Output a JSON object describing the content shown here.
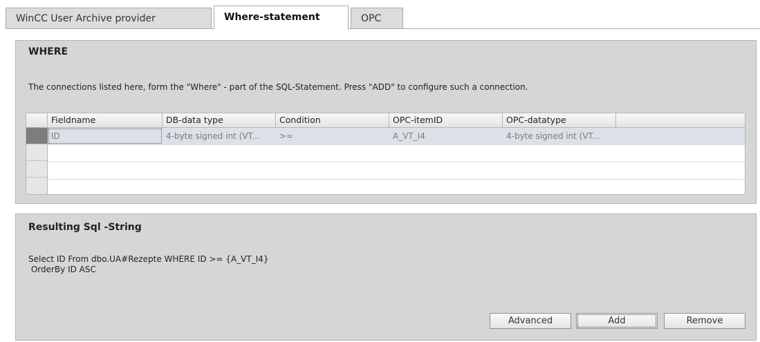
{
  "tabs": [
    {
      "label": "WinCC User Archive provider",
      "active": false
    },
    {
      "label": "Where-statement",
      "active": true
    },
    {
      "label": "OPC",
      "active": false
    }
  ],
  "where": {
    "title": "WHERE",
    "description": "The connections listed here,  form the \"Where\" - part of the SQL-Statement. Press \"ADD\" to configure such a connection.",
    "columns": [
      "Fieldname",
      "DB-data type",
      "Condition",
      "OPC-itemID",
      "OPC-datatype"
    ],
    "rows": [
      {
        "fieldname": "ID",
        "db_type": "4-byte signed int (VT...",
        "condition": ">=",
        "opc_item": "A_VT_I4",
        "opc_type": "4-byte signed int (VT..."
      }
    ]
  },
  "result": {
    "title": "Resulting Sql -String",
    "sql_line1": "Select ID From dbo.UA#Rezepte WHERE ID >= {A_VT_I4}",
    "sql_line2": " OrderBy ID ASC"
  },
  "buttons": {
    "advanced": "Advanced",
    "add": "Add",
    "remove": "Remove"
  }
}
